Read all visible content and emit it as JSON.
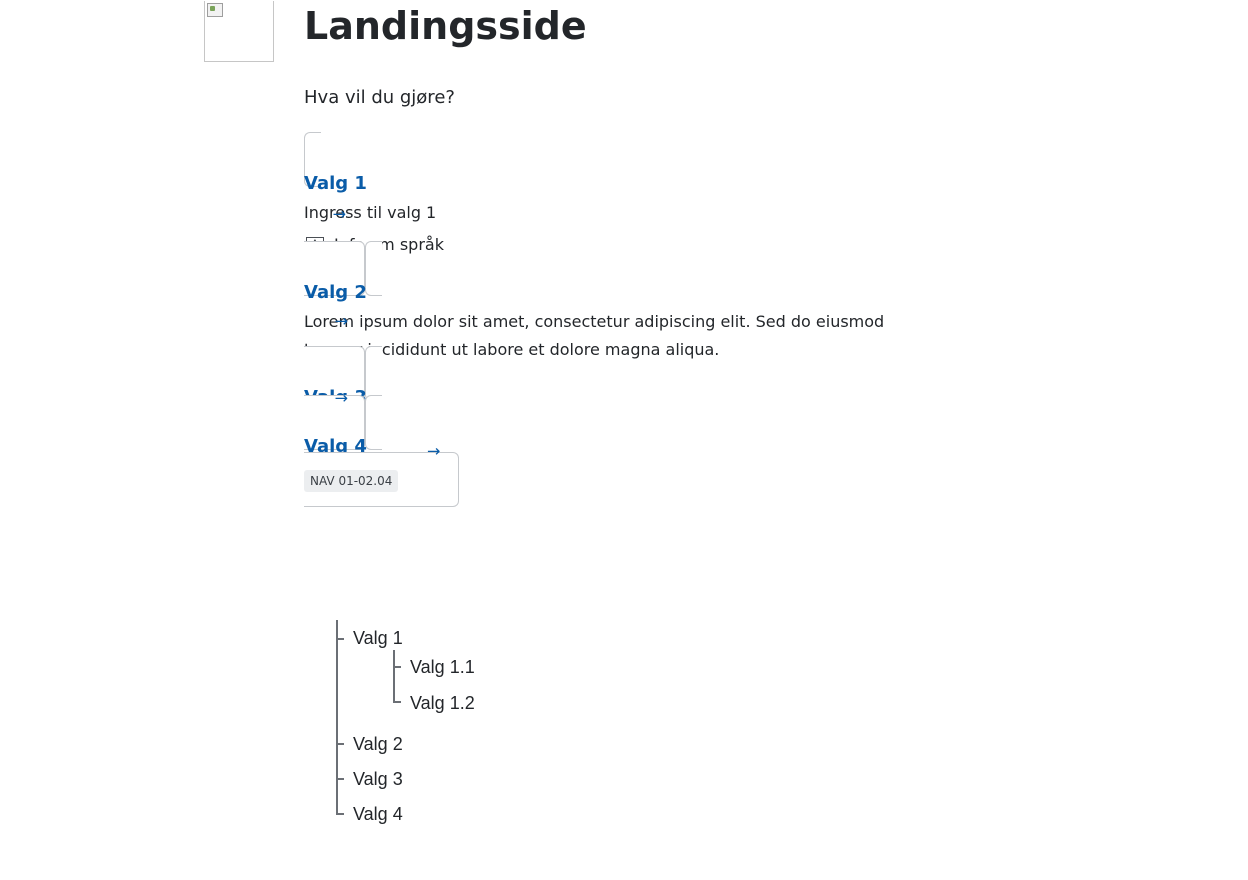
{
  "page": {
    "title": "Landingsside",
    "intro": "Hva vil du gjøre?"
  },
  "cards": [
    {
      "title": "Valg 1",
      "text": "Ingress til valg 1",
      "meta": "Info om språk"
    },
    {
      "title": "Valg 2",
      "text": "Lorem ipsum dolor sit amet, consectetur adipiscing elit. Sed do eiusmod tempor incididunt ut labore et dolore magna aliqua."
    },
    {
      "title": "Valg 3"
    },
    {
      "title": "Valg 4",
      "tag": "NAV 01-02.04"
    }
  ],
  "tree": {
    "items": [
      {
        "label": "Valg 1",
        "children": [
          "Valg 1.1",
          "Valg 1.2"
        ]
      },
      {
        "label": "Valg 2"
      },
      {
        "label": "Valg 3"
      },
      {
        "label": "Valg 4"
      }
    ]
  },
  "icons": {
    "arrow": "arrow-right-icon",
    "info": "info-icon",
    "logo": "broken-image-icon"
  },
  "colors": {
    "link": "#0a5ca8",
    "text": "#23262a",
    "border": "#c6c9cd",
    "tag_bg": "#eceef0"
  }
}
